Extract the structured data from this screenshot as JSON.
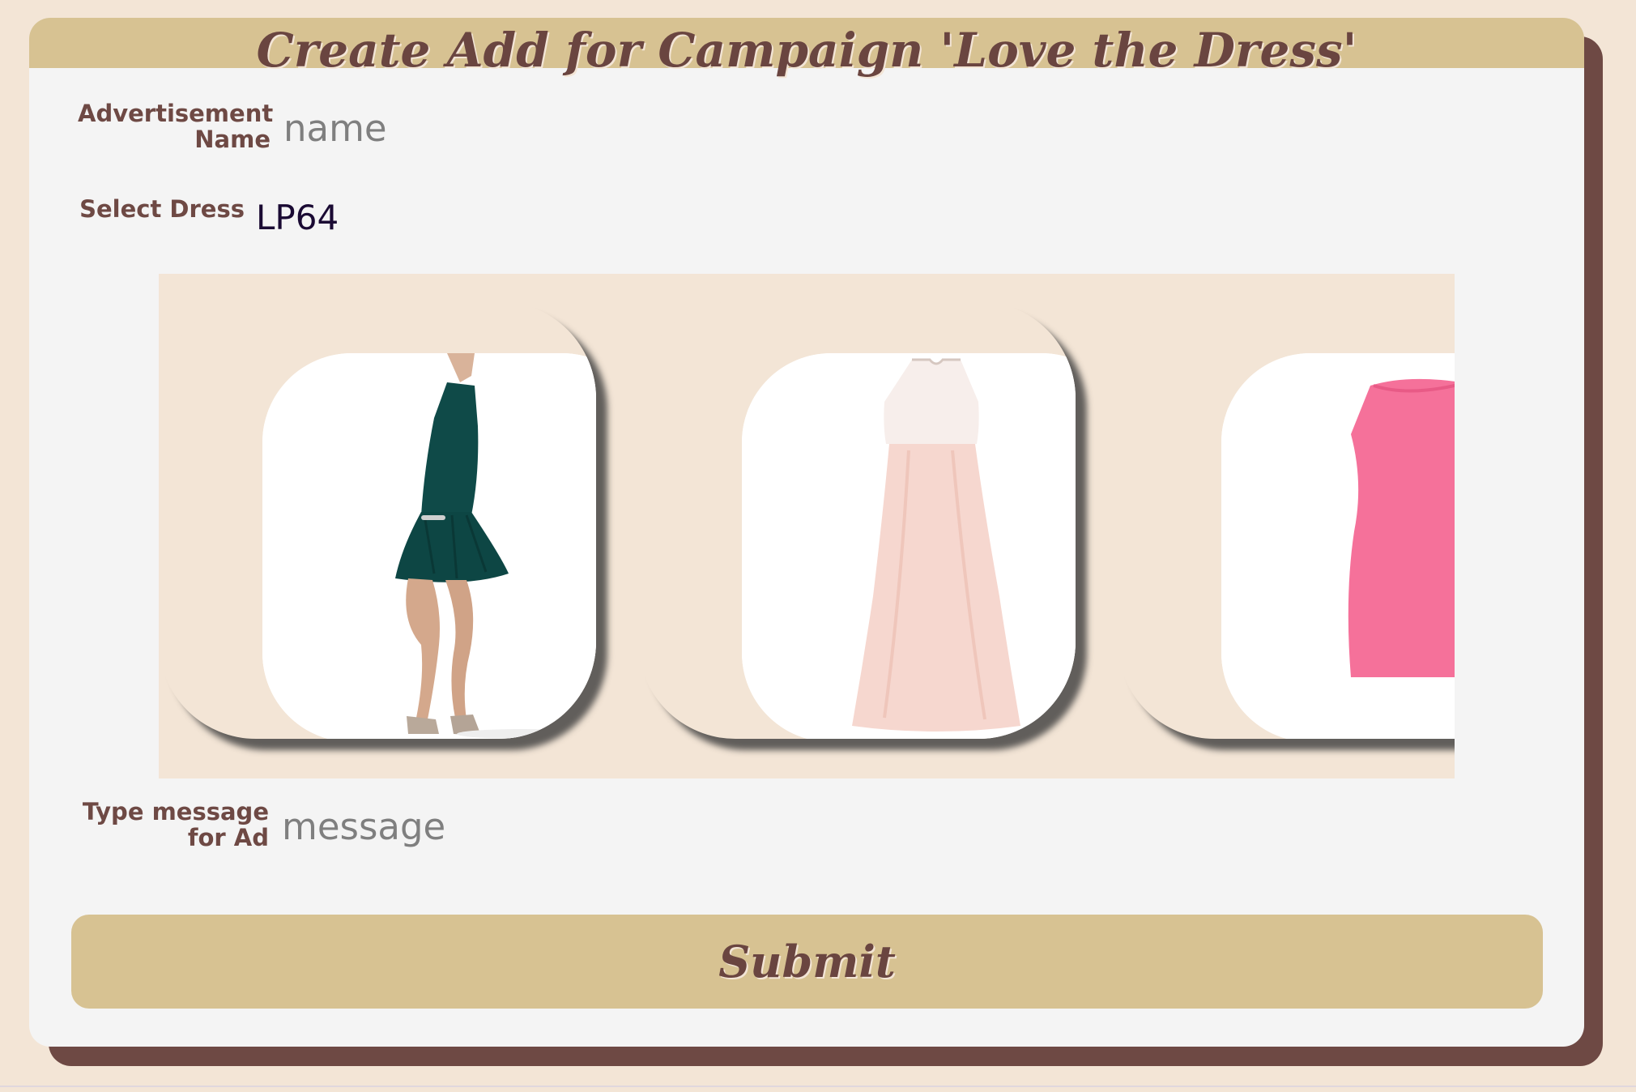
{
  "form": {
    "title": "Create Add for Campaign 'Love the Dress'",
    "ad_name_label_line1": "Advertisement",
    "ad_name_label_line2": "Name",
    "ad_name_placeholder": "name",
    "select_dress_label": "Select Dress",
    "selected_dress": "LP64",
    "message_label_line1": "Type message",
    "message_label_line2": "for Ad",
    "message_placeholder": "message",
    "submit_label": "Submit"
  },
  "carousel": {
    "items": [
      {
        "name": "teal-dress"
      },
      {
        "name": "blush-dress"
      },
      {
        "name": "pink-dress"
      }
    ]
  },
  "colors": {
    "page_bg": "#f3e5d6",
    "header": "#d7c292",
    "accent_text": "#6e4944",
    "card_bg": "#f4f4f4",
    "card_shadow": "#6e4944"
  }
}
